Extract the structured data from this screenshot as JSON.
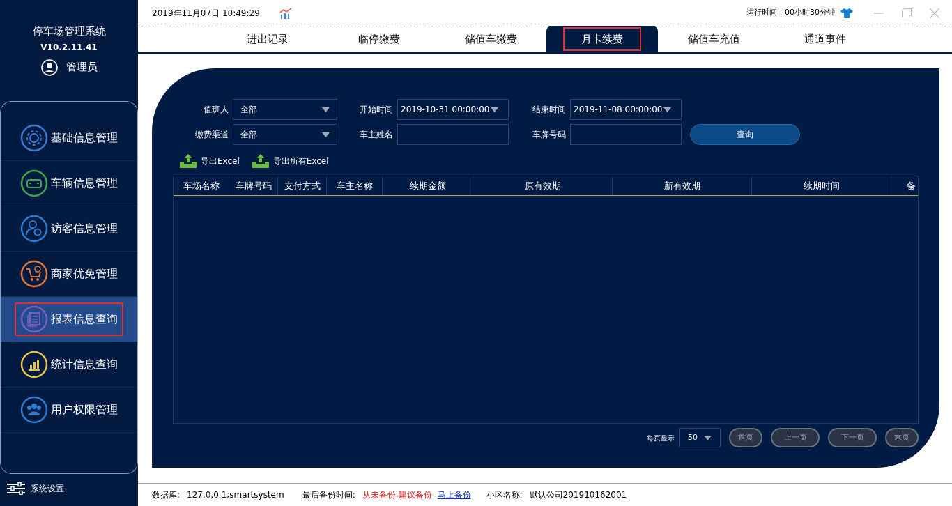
{
  "app": {
    "title": "停车场管理系统",
    "version": "V10.2.11.41",
    "user": "管理员"
  },
  "sidebar": {
    "items": [
      {
        "label": "基础信息管理",
        "kind": "gear",
        "color": "#3a7bd5",
        "selected": false
      },
      {
        "label": "车辆信息管理",
        "kind": "car",
        "color": "#3fa34d",
        "selected": false
      },
      {
        "label": "访客信息管理",
        "kind": "visitor",
        "color": "#2a7fd4",
        "selected": false
      },
      {
        "label": "商家优免管理",
        "kind": "cart",
        "color": "#e0773a",
        "selected": false
      },
      {
        "label": "报表信息查询",
        "kind": "report",
        "color": "#7a5cc4",
        "selected": true
      },
      {
        "label": "统计信息查询",
        "kind": "stats",
        "color": "#e8c34a",
        "selected": false
      },
      {
        "label": "用户权限管理",
        "kind": "users",
        "color": "#2a7fd4",
        "selected": false
      }
    ],
    "settings": "系统设置"
  },
  "header": {
    "datetime": "2019年11月07日 10:49:29",
    "uptime": "运行时间：00小时30分钟"
  },
  "tabs": [
    {
      "label": "进出记录",
      "selected": false
    },
    {
      "label": "临停缴费",
      "selected": false
    },
    {
      "label": "储值车缴费",
      "selected": false
    },
    {
      "label": "月卡续费",
      "selected": true
    },
    {
      "label": "储值车充值",
      "selected": false
    },
    {
      "label": "通道事件",
      "selected": false
    }
  ],
  "filters": [
    {
      "label": "值班人",
      "kind": "select",
      "value": "全部"
    },
    {
      "label": "开始时间",
      "kind": "select",
      "value": "2019-10-31 00:00:00"
    },
    {
      "label": "结束时间",
      "kind": "select",
      "value": "2019-11-08 00:00:00"
    },
    {
      "label": "缴费渠道",
      "kind": "select",
      "value": "全部"
    },
    {
      "label": "车主姓名",
      "kind": "input"
    },
    {
      "label": "车牌号码",
      "kind": "input"
    }
  ],
  "query_button": "查询",
  "exports": [
    "导出Excel",
    "导出所有Excel"
  ],
  "table": {
    "columns": [
      "车场名称",
      "车牌号码",
      "支付方式",
      "车主名称",
      "续期金额",
      "原有效期",
      "新有效期",
      "续期时间",
      "备"
    ]
  },
  "pager": {
    "label": "每页显示",
    "page_size": "50",
    "buttons": [
      "首页",
      "上一页",
      "下一页",
      "末页"
    ]
  },
  "status_bar": {
    "db_label": "数据库:",
    "db_value": "127.0.0.1;smartsystem",
    "backup_label": "最后备份时间:",
    "backup_value": "从未备份,建议备份",
    "backup_link": "马上备份",
    "community_label": "小区名称:",
    "community_value": "默认公司201910162001"
  }
}
